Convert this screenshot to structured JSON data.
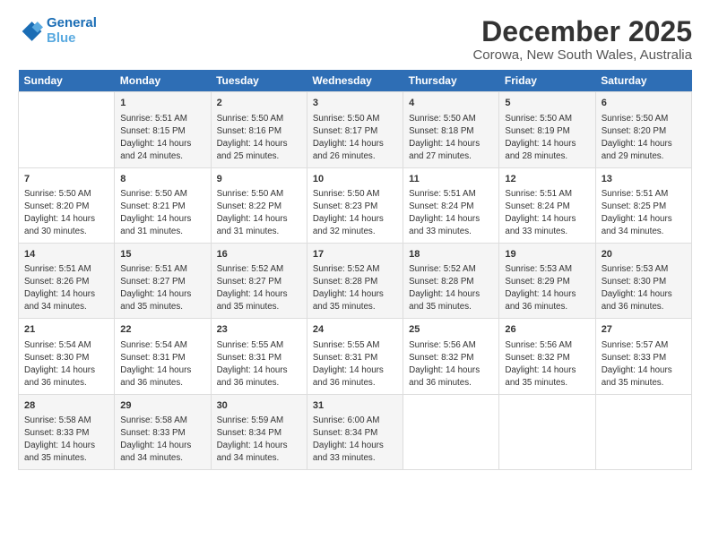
{
  "logo": {
    "line1": "General",
    "line2": "Blue"
  },
  "title": "December 2025",
  "subtitle": "Corowa, New South Wales, Australia",
  "weekdays": [
    "Sunday",
    "Monday",
    "Tuesday",
    "Wednesday",
    "Thursday",
    "Friday",
    "Saturday"
  ],
  "weeks": [
    [
      {
        "day": "",
        "info": ""
      },
      {
        "day": "1",
        "info": "Sunrise: 5:51 AM\nSunset: 8:15 PM\nDaylight: 14 hours\nand 24 minutes."
      },
      {
        "day": "2",
        "info": "Sunrise: 5:50 AM\nSunset: 8:16 PM\nDaylight: 14 hours\nand 25 minutes."
      },
      {
        "day": "3",
        "info": "Sunrise: 5:50 AM\nSunset: 8:17 PM\nDaylight: 14 hours\nand 26 minutes."
      },
      {
        "day": "4",
        "info": "Sunrise: 5:50 AM\nSunset: 8:18 PM\nDaylight: 14 hours\nand 27 minutes."
      },
      {
        "day": "5",
        "info": "Sunrise: 5:50 AM\nSunset: 8:19 PM\nDaylight: 14 hours\nand 28 minutes."
      },
      {
        "day": "6",
        "info": "Sunrise: 5:50 AM\nSunset: 8:20 PM\nDaylight: 14 hours\nand 29 minutes."
      }
    ],
    [
      {
        "day": "7",
        "info": "Sunrise: 5:50 AM\nSunset: 8:20 PM\nDaylight: 14 hours\nand 30 minutes."
      },
      {
        "day": "8",
        "info": "Sunrise: 5:50 AM\nSunset: 8:21 PM\nDaylight: 14 hours\nand 31 minutes."
      },
      {
        "day": "9",
        "info": "Sunrise: 5:50 AM\nSunset: 8:22 PM\nDaylight: 14 hours\nand 31 minutes."
      },
      {
        "day": "10",
        "info": "Sunrise: 5:50 AM\nSunset: 8:23 PM\nDaylight: 14 hours\nand 32 minutes."
      },
      {
        "day": "11",
        "info": "Sunrise: 5:51 AM\nSunset: 8:24 PM\nDaylight: 14 hours\nand 33 minutes."
      },
      {
        "day": "12",
        "info": "Sunrise: 5:51 AM\nSunset: 8:24 PM\nDaylight: 14 hours\nand 33 minutes."
      },
      {
        "day": "13",
        "info": "Sunrise: 5:51 AM\nSunset: 8:25 PM\nDaylight: 14 hours\nand 34 minutes."
      }
    ],
    [
      {
        "day": "14",
        "info": "Sunrise: 5:51 AM\nSunset: 8:26 PM\nDaylight: 14 hours\nand 34 minutes."
      },
      {
        "day": "15",
        "info": "Sunrise: 5:51 AM\nSunset: 8:27 PM\nDaylight: 14 hours\nand 35 minutes."
      },
      {
        "day": "16",
        "info": "Sunrise: 5:52 AM\nSunset: 8:27 PM\nDaylight: 14 hours\nand 35 minutes."
      },
      {
        "day": "17",
        "info": "Sunrise: 5:52 AM\nSunset: 8:28 PM\nDaylight: 14 hours\nand 35 minutes."
      },
      {
        "day": "18",
        "info": "Sunrise: 5:52 AM\nSunset: 8:28 PM\nDaylight: 14 hours\nand 35 minutes."
      },
      {
        "day": "19",
        "info": "Sunrise: 5:53 AM\nSunset: 8:29 PM\nDaylight: 14 hours\nand 36 minutes."
      },
      {
        "day": "20",
        "info": "Sunrise: 5:53 AM\nSunset: 8:30 PM\nDaylight: 14 hours\nand 36 minutes."
      }
    ],
    [
      {
        "day": "21",
        "info": "Sunrise: 5:54 AM\nSunset: 8:30 PM\nDaylight: 14 hours\nand 36 minutes."
      },
      {
        "day": "22",
        "info": "Sunrise: 5:54 AM\nSunset: 8:31 PM\nDaylight: 14 hours\nand 36 minutes."
      },
      {
        "day": "23",
        "info": "Sunrise: 5:55 AM\nSunset: 8:31 PM\nDaylight: 14 hours\nand 36 minutes."
      },
      {
        "day": "24",
        "info": "Sunrise: 5:55 AM\nSunset: 8:31 PM\nDaylight: 14 hours\nand 36 minutes."
      },
      {
        "day": "25",
        "info": "Sunrise: 5:56 AM\nSunset: 8:32 PM\nDaylight: 14 hours\nand 36 minutes."
      },
      {
        "day": "26",
        "info": "Sunrise: 5:56 AM\nSunset: 8:32 PM\nDaylight: 14 hours\nand 35 minutes."
      },
      {
        "day": "27",
        "info": "Sunrise: 5:57 AM\nSunset: 8:33 PM\nDaylight: 14 hours\nand 35 minutes."
      }
    ],
    [
      {
        "day": "28",
        "info": "Sunrise: 5:58 AM\nSunset: 8:33 PM\nDaylight: 14 hours\nand 35 minutes."
      },
      {
        "day": "29",
        "info": "Sunrise: 5:58 AM\nSunset: 8:33 PM\nDaylight: 14 hours\nand 34 minutes."
      },
      {
        "day": "30",
        "info": "Sunrise: 5:59 AM\nSunset: 8:34 PM\nDaylight: 14 hours\nand 34 minutes."
      },
      {
        "day": "31",
        "info": "Sunrise: 6:00 AM\nSunset: 8:34 PM\nDaylight: 14 hours\nand 33 minutes."
      },
      {
        "day": "",
        "info": ""
      },
      {
        "day": "",
        "info": ""
      },
      {
        "day": "",
        "info": ""
      }
    ]
  ]
}
